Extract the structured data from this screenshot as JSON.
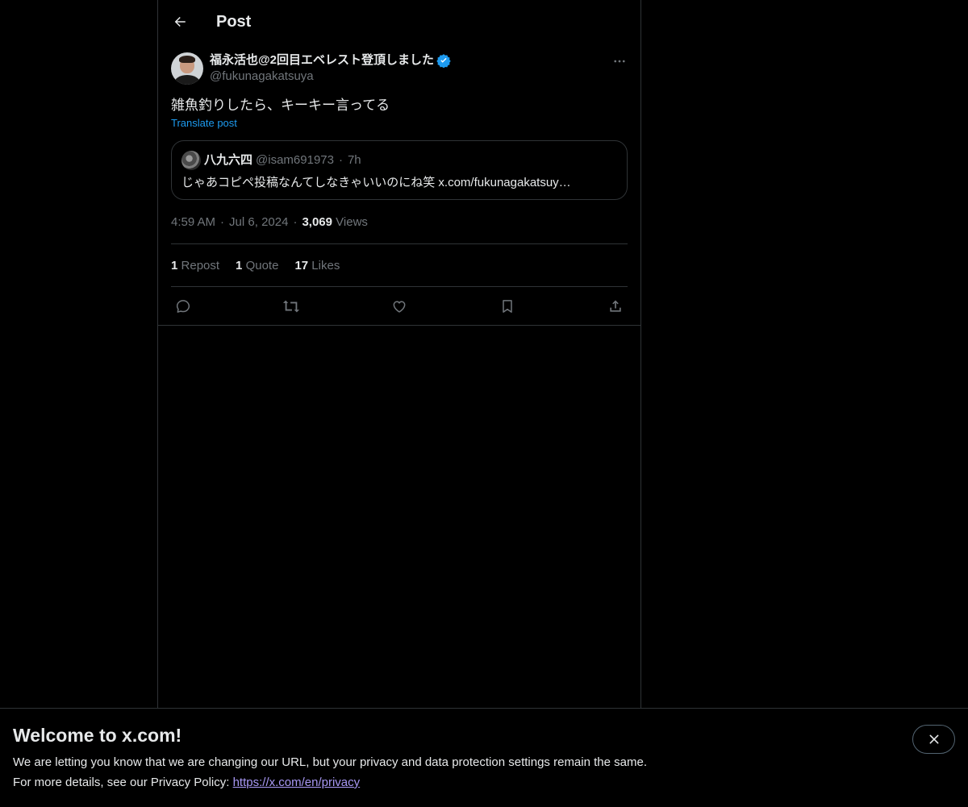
{
  "header": {
    "title": "Post"
  },
  "author": {
    "display_name": "福永活也@2回目エベレスト登頂しました",
    "handle": "@fukunagakatsuya"
  },
  "post": {
    "text": "雑魚釣りしたら、キーキー言ってる",
    "translate_label": "Translate post"
  },
  "quote": {
    "name": "八九六四",
    "handle": "@isam691973",
    "separator": "·",
    "time": "7h",
    "text": "じゃあコピペ投稿なんてしなきゃいいのにね笑 x.com/fukunagakatsuy…"
  },
  "meta": {
    "time": "4:59 AM",
    "separator": "·",
    "date": "Jul 6, 2024",
    "views_count": "3,069",
    "views_label": "Views"
  },
  "stats": {
    "reposts_count": "1",
    "reposts_label": "Repost",
    "quotes_count": "1",
    "quotes_label": "Quote",
    "likes_count": "17",
    "likes_label": "Likes"
  },
  "banner": {
    "title": "Welcome to x.com!",
    "line1": "We are letting you know that we are changing our URL, but your privacy and data protection settings remain the same.",
    "line2_prefix": "For more details, see our Privacy Policy: ",
    "link": "https://x.com/en/privacy"
  },
  "icons": {
    "back": "arrow-left-icon",
    "verified": "verified-badge-icon",
    "more": "more-horizontal-icon",
    "reply": "reply-icon",
    "repost": "repost-icon",
    "like": "heart-icon",
    "bookmark": "bookmark-icon",
    "share": "share-icon",
    "close": "close-icon"
  },
  "colors": {
    "accent": "#1d9bf0",
    "link": "#a898f5",
    "muted": "#71767b",
    "border": "#2f3336"
  }
}
